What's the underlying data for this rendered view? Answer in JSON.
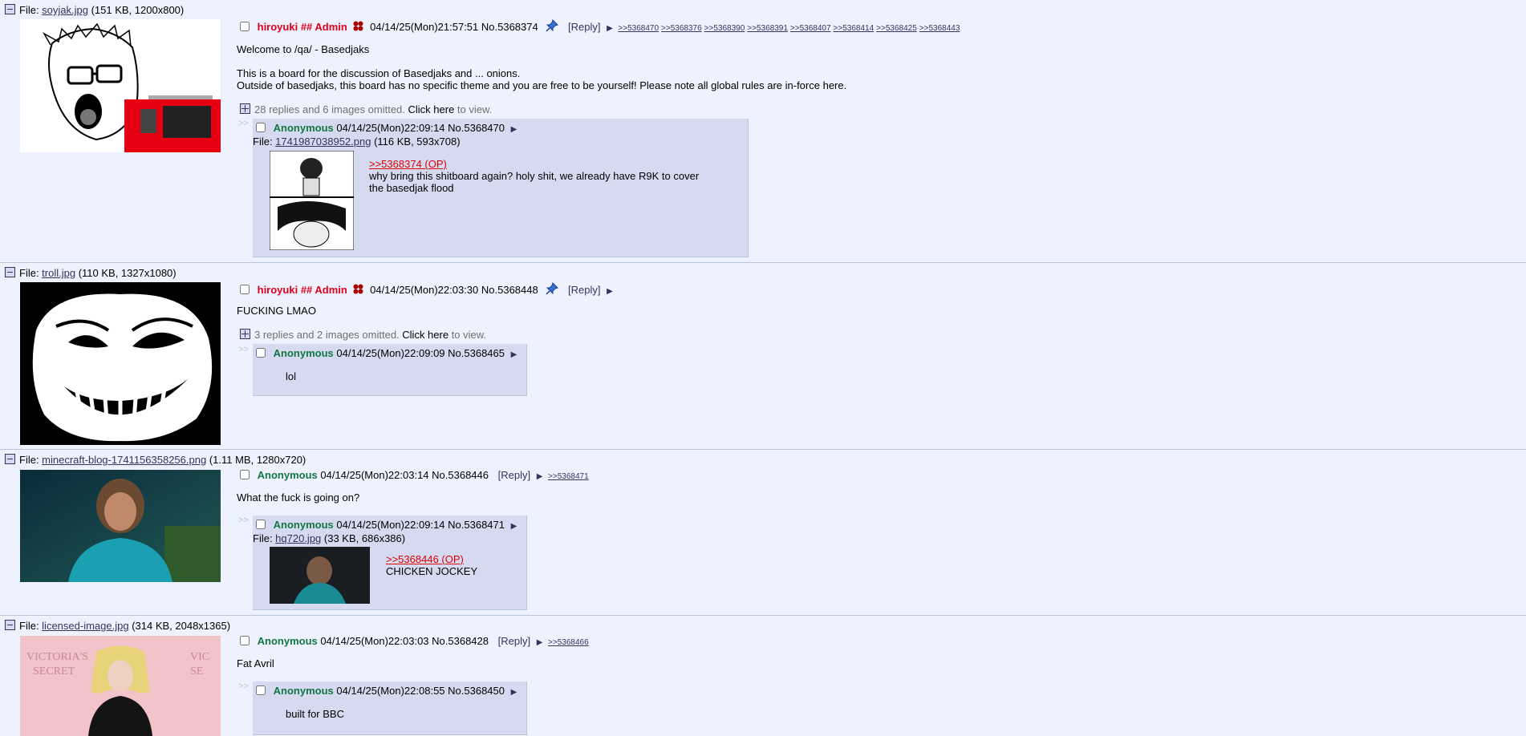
{
  "threads": [
    {
      "file_prefix": "File: ",
      "file_name": "soyjak.jpg",
      "file_meta": " (151 KB, 1200x800)",
      "checkbox": false,
      "name": "hiroyuki",
      "capcode": "## Admin",
      "date": "04/14/25(Mon)21:57:51",
      "post_no": "No.5368374",
      "reply_label": "[Reply]",
      "arrow": "▶",
      "backlinks": [
        ">>5368470",
        ">>5368376",
        ">>5368390",
        ">>5368391",
        ">>5368407",
        ">>5368414",
        ">>5368425",
        ">>5368443"
      ],
      "body": [
        "Welcome to /qa/ - Basedjaks",
        "",
        "This is a board for the discussion of Basedjaks and ... onions.",
        "Outside of basedjaks, this board has no specific theme and you are free to be yourself! Please note all global rules are in-force here."
      ],
      "omitted_a": "28 replies and 6 images omitted. ",
      "omitted_click": "Click here",
      "omitted_b": " to view.",
      "reply": {
        "name": "Anonymous",
        "date": "04/14/25(Mon)22:09:14",
        "post_no": "No.5368470",
        "file_prefix": "File: ",
        "file_name": "1741987038952.png",
        "file_meta": " (116 KB, 593x708)",
        "quote": ">>5368374 (OP)",
        "lines": [
          "why bring this shitboard again? holy shit, we already have R9K to cover",
          "the basedjak flood"
        ]
      }
    },
    {
      "file_prefix": "File: ",
      "file_name": "troll.jpg",
      "file_meta": " (110 KB, 1327x1080)",
      "name": "hiroyuki",
      "capcode": "## Admin",
      "date": "04/14/25(Mon)22:03:30",
      "post_no": "No.5368448",
      "reply_label": "[Reply]",
      "arrow": "▶",
      "body": [
        "FUCKING LMAO"
      ],
      "omitted_a": "3 replies and 2 images omitted. ",
      "omitted_click": "Click here",
      "omitted_b": " to view.",
      "reply": {
        "name": "Anonymous",
        "date": "04/14/25(Mon)22:09:09",
        "post_no": "No.5368465",
        "lines": [
          "lol"
        ]
      }
    },
    {
      "file_prefix": "File: ",
      "file_name": "minecraft-blog-1741156358256.png",
      "file_meta": " (1.11 MB, 1280x720)",
      "name": "Anonymous",
      "date": "04/14/25(Mon)22:03:14",
      "post_no": "No.5368446",
      "reply_label": "[Reply]",
      "arrow": "▶",
      "backlinks": [
        ">>5368471"
      ],
      "body": [
        "What the fuck is going on?"
      ],
      "reply": {
        "name": "Anonymous",
        "date": "04/14/25(Mon)22:09:14",
        "post_no": "No.5368471",
        "file_prefix": "File: ",
        "file_name": "hq720.jpg",
        "file_meta": " (33 KB, 686x386)",
        "quote": ">>5368446 (OP)",
        "lines": [
          "CHICKEN JOCKEY"
        ]
      }
    },
    {
      "file_prefix": "File: ",
      "file_name": "licensed-image.jpg",
      "file_meta": " (314 KB, 2048x1365)",
      "name": "Anonymous",
      "date": "04/14/25(Mon)22:03:03",
      "post_no": "No.5368428",
      "reply_label": "[Reply]",
      "arrow": "▶",
      "backlinks": [
        ">>5368466"
      ],
      "body": [
        "Fat Avril"
      ],
      "thumb_text": [
        "VICTORIA'S",
        "SECRET",
        "VIC",
        "SE"
      ],
      "reply": {
        "name": "Anonymous",
        "date": "04/14/25(Mon)22:08:55",
        "post_no": "No.5368450",
        "lines": [
          "built for BBC"
        ]
      }
    }
  ],
  "side_arrows": ">>",
  "colors": {
    "background": "#eef2ff",
    "reply_bg": "#d6daf0",
    "admin_name": "#e0001b",
    "anon_name": "#117743",
    "quote": "#dd0000"
  }
}
